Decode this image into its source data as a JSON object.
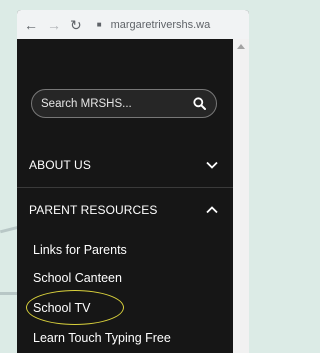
{
  "browser": {
    "back_icon": "arrow-left-icon",
    "forward_icon": "arrow-right-icon",
    "reload_icon": "reload-icon",
    "address": "margaretrivershs.wa"
  },
  "search": {
    "placeholder": "Search MRSHS...",
    "icon": "search-icon"
  },
  "menu": {
    "about": {
      "label": "ABOUT US",
      "icon": "chevron-down-icon"
    },
    "parent_resources": {
      "label": "PARENT RESOURCES",
      "icon": "chevron-up-icon",
      "items": [
        {
          "label": "Links for Parents"
        },
        {
          "label": "School Canteen"
        },
        {
          "label": "School TV"
        },
        {
          "label": "Learn Touch Typing Free"
        }
      ]
    }
  },
  "annotation": {
    "highlighted_item": "School TV",
    "color": "#d9d13c"
  }
}
